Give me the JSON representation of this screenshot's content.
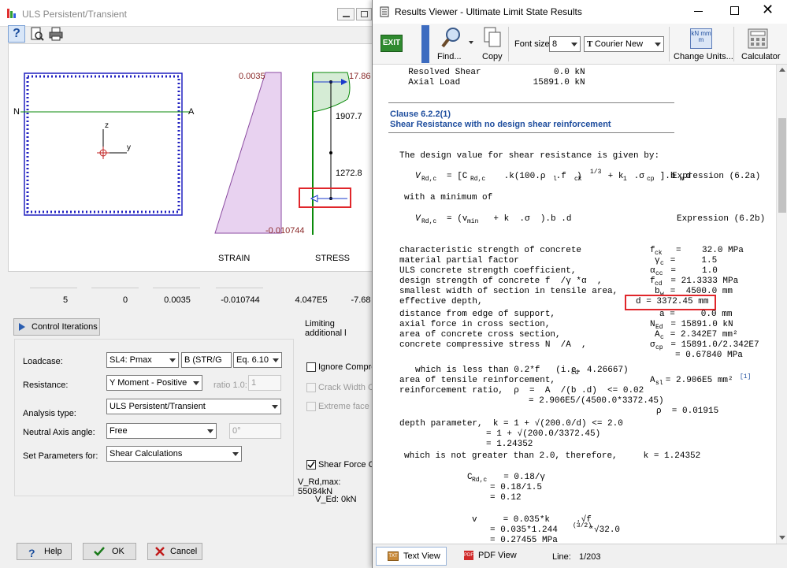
{
  "back_window": {
    "title": "ULS Persistent/Transient",
    "plot": {
      "n_label": "N",
      "a_label": "A",
      "z_label": "z",
      "y_label": "y",
      "strain_top": "0.0035",
      "strain_bottom": "-0.010744",
      "stress_top": "17.86",
      "force_1": "1907.7",
      "force_2": "1272.8",
      "strain_caption": "STRAIN",
      "stress_caption": "STRESS"
    },
    "values_row": [
      "5",
      "0",
      "0.0035",
      "-0.010744",
      "4.047E5",
      "-7.68"
    ],
    "control_iterations": "Control Iterations",
    "limiting_text": "Limiting additional l",
    "loadcase_label": "Loadcase:",
    "loadcase_value": "SL4: Pmax",
    "loadcase_combo2": "B (STR/G",
    "loadcase_combo3": "Eq. 6.10",
    "resistance_label": "Resistance:",
    "resistance_value": "Y Moment - Positive",
    "ratio_label": "ratio 1.0:",
    "ratio_value": "1",
    "analysis_label": "Analysis type:",
    "analysis_value": "ULS Persistent/Transient",
    "neutral_label": "Neutral Axis angle:",
    "neutral_value": "Free",
    "neutral_angle": "0°",
    "setparams_label": "Set Parameters for:",
    "setparams_value": "Shear Calculations",
    "ignore_label": "Ignore Compre",
    "crack_label": "Crack Width Ca",
    "extreme_label": "Extreme face o",
    "shear_force_label": "Shear Force Ca",
    "vrd_max": "V_Rd,max: 55084kN",
    "ved": "V_Ed: 0kN",
    "help_btn": "Help",
    "ok_btn": "OK",
    "cancel_btn": "Cancel"
  },
  "results": {
    "title": "Results Viewer - Ultimate Limit State Results",
    "toolbar": {
      "exit": "EXIT",
      "find": "Find...",
      "copy": "Copy",
      "font_size_label": "Font size",
      "font_size_value": "8",
      "font_name": "Courier New",
      "change_units": "Change Units...",
      "calculator": "Calculator",
      "units_icon": "kN mm m"
    },
    "lines": {
      "resolved_shear": "  Resolved Shear              0.0 kN",
      "axial_load": "  Axial Load              15891.0 kN",
      "clause": "Clause 6.2.2(1)",
      "clause_sub": "Shear Resistance with no design shear reinforcement",
      "design_value": "The design value for shear resistance is given by:",
      "vrdc_expr": "V",
      "vrdc_formula": "= [C       .k(100.ρ  .f  )     + k  .σ   ].b .d",
      "vrdc_sub": "Rd,c",
      "vrdc_crdc": "Rd,c",
      "vrdc_l": "l",
      "vrdc_ck": "ck",
      "vrdc_13": "1/3",
      "vrdc_1": "1",
      "vrdc_cp": "cp",
      "vrdc_w": "w",
      "expr_62a": "Expression (6.2a)",
      "with_min": "with a minimum of",
      "vmin_formula": "= (v     + k  .σ  ).b .d",
      "vmin_min": "min",
      "expr_62b": "Expression (6.2b)",
      "r1_l": "characteristic strength of concrete",
      "r1_r": "f    =    32.0 MPa",
      "r1_s": "ck",
      "r2_l": "material partial factor",
      "r2_r": "γ  =     1.5",
      "r2_s": "c",
      "r3_l": "ULS concrete strength coefficient,",
      "r3_r": "α   =     1.0",
      "r3_s": "cc",
      "r4_l": "design strength of concrete f  /γ *α  ,",
      "r4_r": "f   = 21.3333 MPa",
      "r4_s": "cd",
      "r5_l": "smallest width of section in tensile area,",
      "r5_r": "b  =  4500.0 mm",
      "r5_s": "w",
      "r6_l": "effective depth,",
      "r6_r": "d = 3372.45 mm",
      "r7_l": "distance from edge of support,",
      "r7_r": "a =     0.0 mm",
      "r8_l": "axial force in cross section,",
      "r8_r": "N   = 15891.0 kN",
      "r8_s": "Ed",
      "r9_l": "area of concrete cross section,",
      "r9_r": "A  = 2.342E7 mm²",
      "r9_s": "c",
      "r10_l": "concrete compressive stress N  /A  ,",
      "r10_r": "σ   = 15891.0/2.342E7",
      "r10_s": "cp",
      "r10_r2": "= 0.67840 MPa",
      "less_than": "which is less than 0.2*f   (i.e. 4.26667)",
      "less_cd": "cd",
      "tensile_l": "area of tensile reinforcement,",
      "tensile_r": "A  = 2.906E5 mm²",
      "tensile_s": "sl",
      "tensile_note": "[1]",
      "ratio_l": "reinforcement ratio,  ρ  =  A  /(b .d)  <= 0.02",
      "ratio_l2": "= 2.906E5/(4500.0*3372.45)",
      "ratio_r": "ρ  = 0.01915",
      "depth_l": "depth parameter,  k = 1 + √(200.0/d) <= 2.0",
      "depth_l2": "= 1 + √(200.0/3372.45)",
      "depth_l3": "= 1.24352",
      "not_greater": "which is not greater than 2.0, therefore,     k = 1.24352",
      "crdc_l": "C      = 0.18/γ",
      "crdc_s": "Rd,c",
      "crdc_l2": "= 0.18/1.5",
      "crdc_l3": "= 0.12",
      "vmin_l": "v     = 0.035*k     .√f",
      "vmin_l2": "= 0.035*1.244      *√32.0",
      "vmin_l3": "= 0.27455 MPa",
      "vmin_32": "(3/2)"
    },
    "status": {
      "text_view": "Text View",
      "pdf_view": "PDF View",
      "line_label": "Line:",
      "line_value": "1/203"
    }
  },
  "colors": {
    "highlight": "#e0262b",
    "clause_blue": "#1f4e9e",
    "strain_fill": "#e8d2f0",
    "stress_fill": "#d5ecd5",
    "section_border": "#2020c0"
  }
}
